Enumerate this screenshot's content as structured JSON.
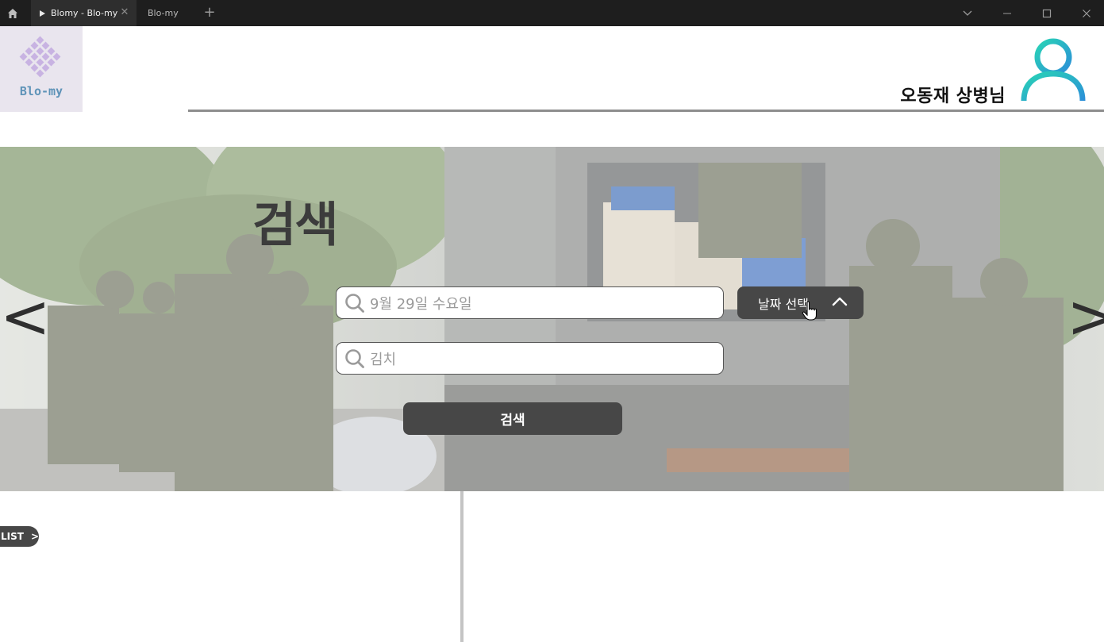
{
  "browser": {
    "active_tab": "Blomy - Blo-my",
    "inactive_tab": "Blo-my",
    "new_tab_symbol": "+",
    "close_symbol": "✕"
  },
  "header": {
    "logo_text": "Blo-my",
    "user_name": "오동재 상병님"
  },
  "hero": {
    "title": "검색",
    "prev_arrow": "<",
    "next_arrow": ">",
    "date_field_placeholder": "9월 29일 수요일",
    "food_field_placeholder": "김치",
    "date_button_label": "날짜 선택",
    "search_button_label": "검색"
  },
  "list": {
    "tab_label": "LIST",
    "tab_arrow": ">"
  },
  "colors": {
    "chrome_bg": "#1e1e1e",
    "button_dark": "#474747",
    "logo_text": "#5e93b8",
    "avatar_gradient_start": "#29d3b6",
    "avatar_gradient_end": "#2b8fd8"
  }
}
